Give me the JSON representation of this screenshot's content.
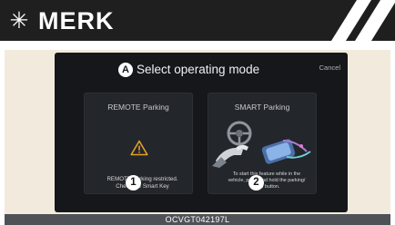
{
  "header": {
    "icon": "asterisk-icon",
    "title": "MERK"
  },
  "screen": {
    "callout_a": "A",
    "title": "Select operating mode",
    "cancel_label": "Cancel",
    "cards": [
      {
        "title": "REMOTE Parking",
        "icon": "warning-icon",
        "callout": "1",
        "caption_line1": "REMOTE Parking restricted.",
        "caption_line2": "Check the Smart Key"
      },
      {
        "title": "SMART Parking",
        "icon": "smart-parking-illustration",
        "callout": "2",
        "caption_line1": "To start this feature while in the",
        "caption_line2": "vehicle, press and hold the parking/",
        "caption_line3": "view button."
      }
    ]
  },
  "figure_code": "OCVGT042197L",
  "colors": {
    "header_bg": "#1f1f1f",
    "figure_bg": "#f2ebdd",
    "screen_bg": "#15171b",
    "card_bg": "#23262b",
    "warning": "#e0a12c",
    "code_bar": "#4e5257"
  }
}
